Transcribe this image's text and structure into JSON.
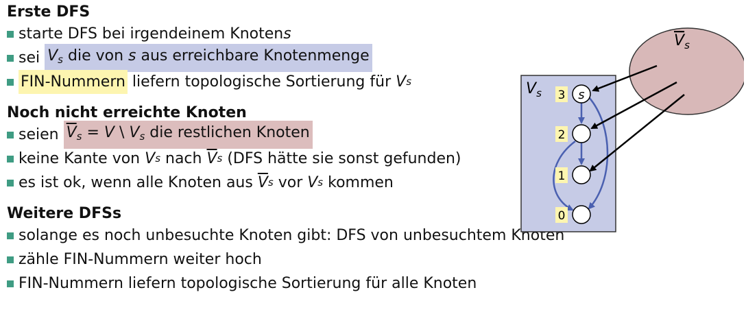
{
  "section1": {
    "heading": "Erste DFS",
    "b1_text": "starte DFS bei irgendeinem Knoten ",
    "b1_var": "s",
    "b2_pre": "sei ",
    "b2_V": "V",
    "b2_s": "s",
    "b2_mid": " die von ",
    "b2_s2": "s",
    "b2_post": " aus erreichbare Knotenmenge",
    "b3_hl": "FIN-Nummern",
    "b3_post": " liefern topologische Sortierung für ",
    "b3_V": "V",
    "b3_s": "s"
  },
  "section2": {
    "heading": "Noch nicht erreichte Knoten",
    "b1_pre": "seien ",
    "b1_V1": "V",
    "b1_s1": "s",
    "b1_eq": " = ",
    "b1_V2": "V",
    "b1_setminus": " \\ ",
    "b1_V3": "V",
    "b1_s3": "s",
    "b1_post": " die restlichen Knoten",
    "b2_pre": "keine Kante von ",
    "b2_V1": "V",
    "b2_s1": "s",
    "b2_mid": " nach ",
    "b2_V2": "V",
    "b2_s2": "s",
    "b2_post": " (DFS hätte sie sonst gefunden)",
    "b3_pre": "es ist ok, wenn alle Knoten aus ",
    "b3_V1": "V",
    "b3_s1": "s",
    "b3_mid": " vor ",
    "b3_V2": "V",
    "b3_s2": "s",
    "b3_post": " kommen"
  },
  "section3": {
    "heading": "Weitere DFSs",
    "b1": "solange es noch unbesuchte Knoten gibt: DFS von unbesuchtem Knoten",
    "b2": "zähle FIN-Nummern weiter hoch",
    "b3": "FIN-Nummern liefern topologische Sortierung für alle Knoten"
  },
  "diagram": {
    "box_label_V": "V",
    "box_label_s": "s",
    "blob_label_V": "V",
    "blob_label_s": "s",
    "node_s_label": "s",
    "fin_numbers": [
      "3",
      "2",
      "1",
      "0"
    ],
    "colors": {
      "box_fill": "#c6cbe6",
      "blob_fill": "#d8b8b8",
      "edge_blue": "#4a60b0",
      "fin_bg": "#fdf5b0"
    }
  }
}
